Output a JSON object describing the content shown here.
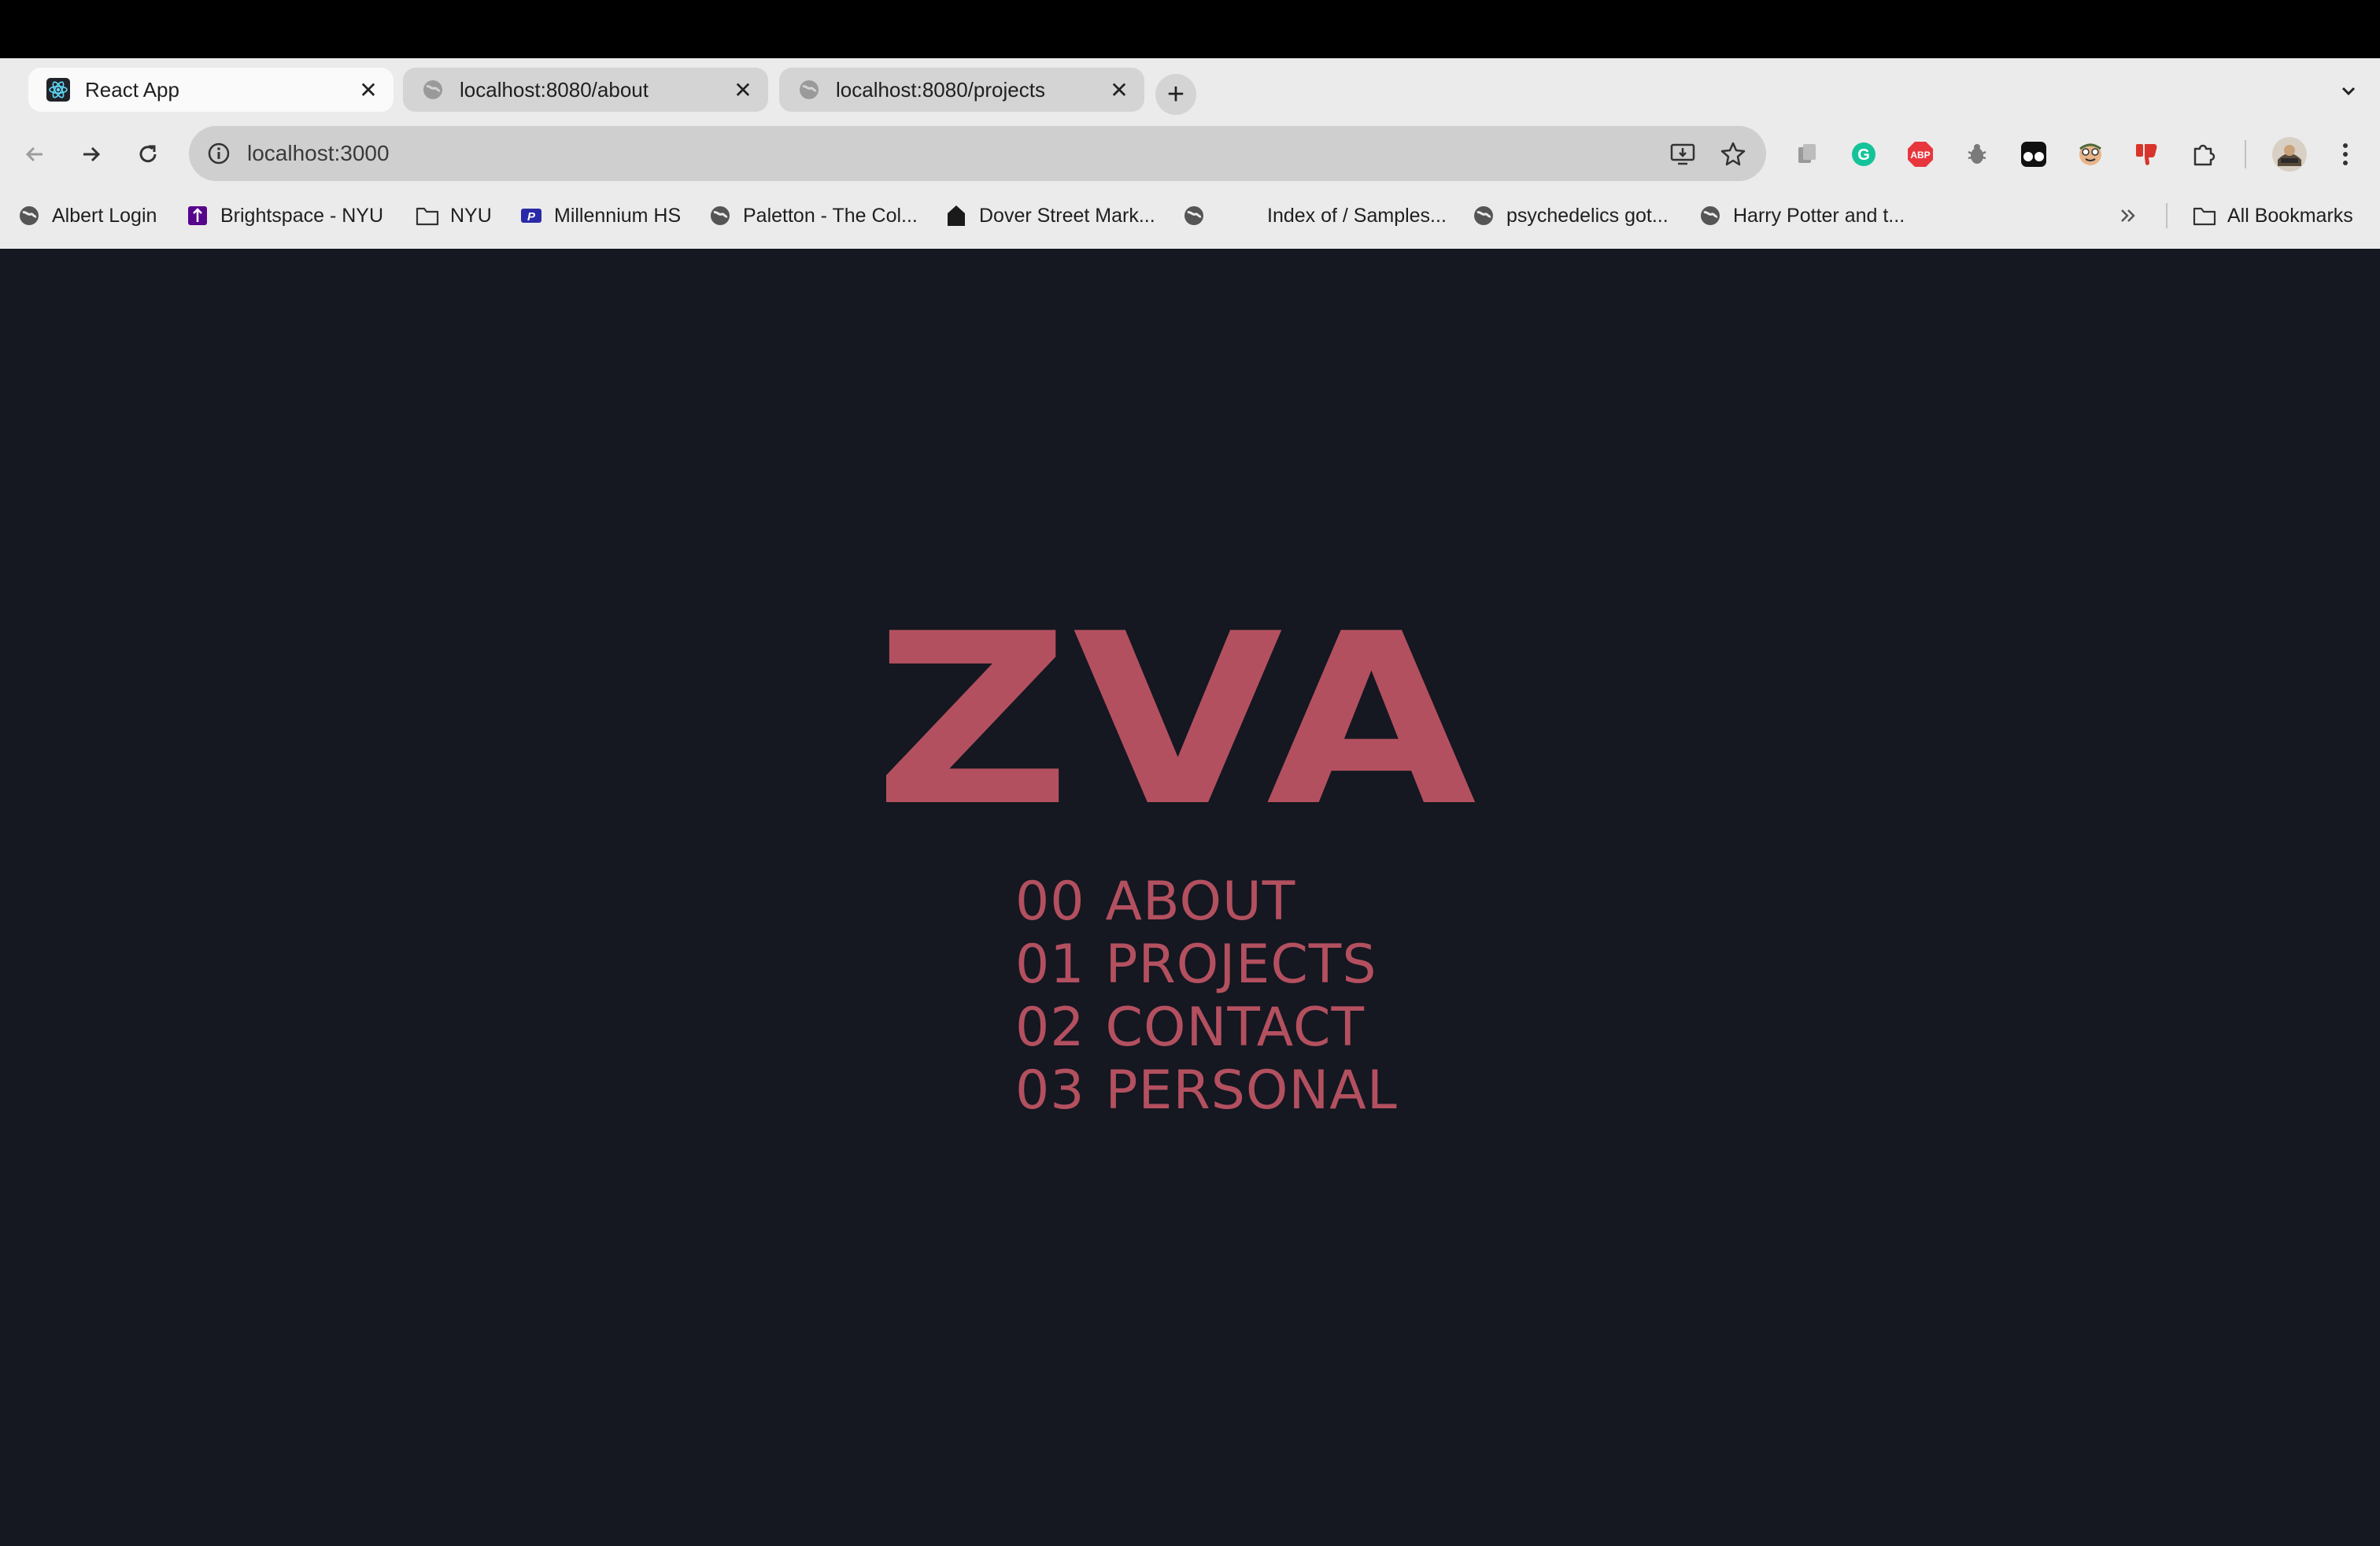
{
  "colors": {
    "accent": "#b3505f",
    "page_bg": "#151721",
    "chrome_bg": "#ebebeb"
  },
  "tabs": [
    {
      "title": "React App",
      "icon": "react-icon",
      "active": true
    },
    {
      "title": "localhost:8080/about",
      "icon": "globe-icon",
      "active": false
    },
    {
      "title": "localhost:8080/projects",
      "icon": "globe-icon",
      "active": false
    }
  ],
  "address_bar": {
    "url": "localhost:3000"
  },
  "bookmarks": [
    {
      "label": "Albert Login",
      "icon": "globe-icon"
    },
    {
      "label": "Brightspace - NYU",
      "icon": "brightspace-icon"
    },
    {
      "label": "NYU",
      "icon": "folder-icon"
    },
    {
      "label": "Millennium HS",
      "icon": "millennium-icon"
    },
    {
      "label": "Paletton - The Col...",
      "icon": "globe-icon"
    },
    {
      "label": "Dover Street Mark...",
      "icon": "house-icon"
    },
    {
      "label": "",
      "icon": "globe-icon"
    },
    {
      "label": "Index of / Samples...",
      "icon": ""
    },
    {
      "label": "psychedelics got...",
      "icon": "globe-icon"
    },
    {
      "label": "Harry Potter and t...",
      "icon": "globe-icon"
    }
  ],
  "all_bookmarks_label": "All Bookmarks",
  "site": {
    "logo": "ZVA",
    "menu": [
      {
        "num": "00",
        "label": "ABOUT"
      },
      {
        "num": "01",
        "label": "PROJECTS"
      },
      {
        "num": "02",
        "label": "CONTACT"
      },
      {
        "num": "03",
        "label": "PERSONAL"
      }
    ]
  }
}
